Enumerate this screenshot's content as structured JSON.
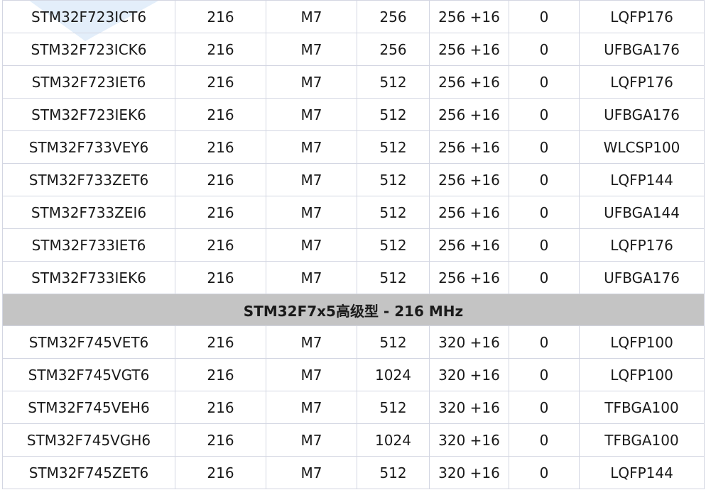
{
  "table": {
    "rows_a": [
      [
        "STM32F723ICT6",
        "216",
        "M7",
        "256",
        "256 +16",
        "0",
        "LQFP176"
      ],
      [
        "STM32F723ICK6",
        "216",
        "M7",
        "256",
        "256 +16",
        "0",
        "UFBGA176"
      ],
      [
        "STM32F723IET6",
        "216",
        "M7",
        "512",
        "256 +16",
        "0",
        "LQFP176"
      ],
      [
        "STM32F723IEK6",
        "216",
        "M7",
        "512",
        "256 +16",
        "0",
        "UFBGA176"
      ],
      [
        "STM32F733VEY6",
        "216",
        "M7",
        "512",
        "256 +16",
        "0",
        "WLCSP100"
      ],
      [
        "STM32F733ZET6",
        "216",
        "M7",
        "512",
        "256 +16",
        "0",
        "LQFP144"
      ],
      [
        "STM32F733ZEI6",
        "216",
        "M7",
        "512",
        "256 +16",
        "0",
        "UFBGA144"
      ],
      [
        "STM32F733IET6",
        "216",
        "M7",
        "512",
        "256 +16",
        "0",
        "LQFP176"
      ],
      [
        "STM32F733IEK6",
        "216",
        "M7",
        "512",
        "256 +16",
        "0",
        "UFBGA176"
      ]
    ],
    "section_header": "STM32F7x5高级型 - 216 MHz",
    "rows_b": [
      [
        "STM32F745VET6",
        "216",
        "M7",
        "512",
        "320 +16",
        "0",
        "LQFP100"
      ],
      [
        "STM32F745VGT6",
        "216",
        "M7",
        "1024",
        "320 +16",
        "0",
        "LQFP100"
      ],
      [
        "STM32F745VEH6",
        "216",
        "M7",
        "512",
        "320 +16",
        "0",
        "TFBGA100"
      ],
      [
        "STM32F745VGH6",
        "216",
        "M7",
        "1024",
        "320 +16",
        "0",
        "TFBGA100"
      ],
      [
        "STM32F745ZET6",
        "216",
        "M7",
        "512",
        "320 +16",
        "0",
        "LQFP144"
      ]
    ]
  },
  "colors": {
    "section_bg": "#c4c4c4",
    "border": "#d3d6e2",
    "watermark": "#dbeaf8"
  }
}
